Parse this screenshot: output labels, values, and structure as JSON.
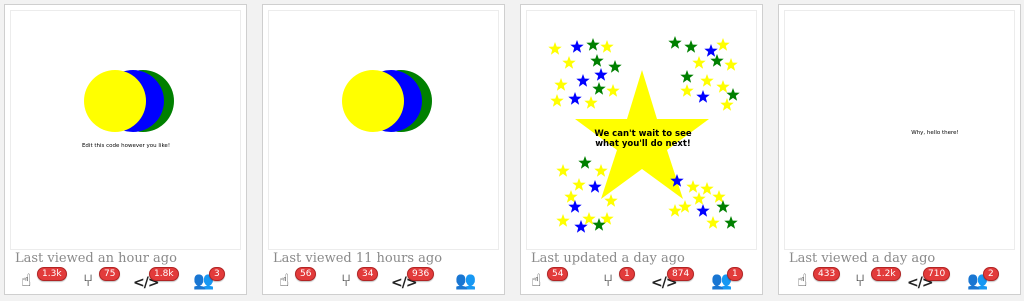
{
  "cards": [
    {
      "preview_text": "Edit this code however you like!",
      "caption": "Last viewed an hour ago",
      "stats": {
        "likes": "1.3k",
        "forks": "75",
        "views": "1.8k",
        "comments": "3"
      }
    },
    {
      "preview_text": "",
      "caption": "Last viewed 11 hours ago",
      "stats": {
        "likes": "56",
        "forks": "34",
        "views": "936",
        "comments": ""
      }
    },
    {
      "preview_text_line1": "We can't wait to see",
      "preview_text_line2": "what you'll do next!",
      "caption": "Last updated a day ago",
      "stats": {
        "likes": "54",
        "forks": "1",
        "views": "874",
        "comments": "1"
      }
    },
    {
      "preview_text": "Why, hello there!",
      "caption": "Last viewed a day ago",
      "stats": {
        "likes": "433",
        "forks": "1.2k",
        "views": "710",
        "comments": "2"
      }
    }
  ],
  "icons": {
    "likes": "hand-pointer-icon",
    "forks": "fork-icon",
    "views": "code-icon",
    "comments": "group-icon"
  },
  "colors": {
    "yellow": "#ffff00",
    "blue": "#0000ff",
    "green": "#008000",
    "badge": "#e23b3b"
  }
}
